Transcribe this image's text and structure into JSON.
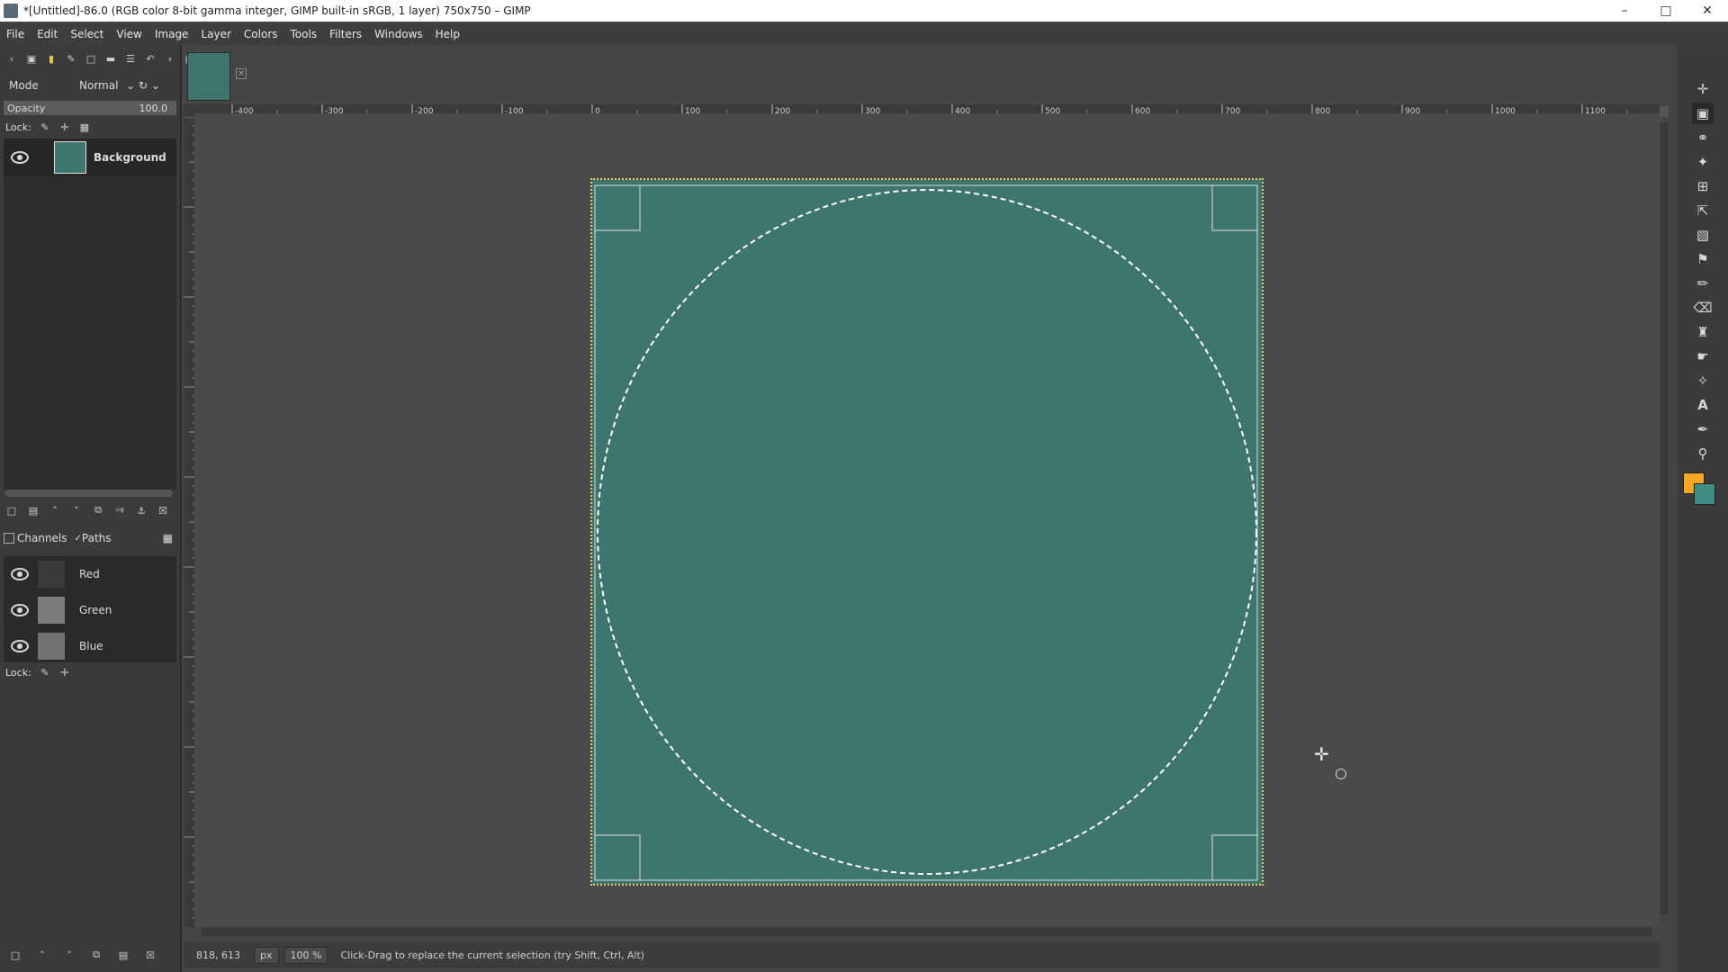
{
  "window": {
    "title": "*[Untitled]-86.0 (RGB color 8-bit gamma integer, GIMP built-in sRGB, 1 layer) 750x750 – GIMP",
    "controls": [
      "–",
      "□",
      "✕"
    ]
  },
  "menu": [
    "File",
    "Edit",
    "Select",
    "View",
    "Image",
    "Layer",
    "Colors",
    "Tools",
    "Filters",
    "Windows",
    "Help"
  ],
  "layers_panel": {
    "mode_label": "Mode",
    "mode_value": "Normal",
    "opacity_label": "Opacity",
    "opacity_value": "100.0",
    "lock_label": "Lock:",
    "layer_name": "Background"
  },
  "channels_panel": {
    "tab_channels": "Channels",
    "tab_paths": "Paths",
    "channels": [
      "Red",
      "Green",
      "Blue"
    ],
    "lock_label": "Lock:"
  },
  "ruler_labels": [
    "-400",
    "-300",
    "-200",
    "-100",
    "0",
    "100",
    "200",
    "300",
    "400",
    "500",
    "600",
    "700",
    "800",
    "900",
    "1000",
    "1100"
  ],
  "statusbar": {
    "coords": "818, 613",
    "unit": "px",
    "zoom": "100 %",
    "message": "Click-Drag to replace the current selection (try Shift, Ctrl, Alt)"
  },
  "colors": {
    "image_fill": "#3f756f",
    "foreground": "#f5a623",
    "background": "#3f8e85",
    "selection_marching_ants": "#d8d27a"
  },
  "tools": [
    "move-tool-icon",
    "rect-select-icon",
    "lasso-icon",
    "fuzzy-select-icon",
    "crop-icon",
    "unified-transform-icon",
    "warp-icon",
    "bucket-fill-icon",
    "paintbrush-icon",
    "eraser-icon",
    "clone-icon",
    "smudge-icon",
    "paths-icon",
    "text-icon",
    "color-picker-icon",
    "zoom-icon"
  ]
}
